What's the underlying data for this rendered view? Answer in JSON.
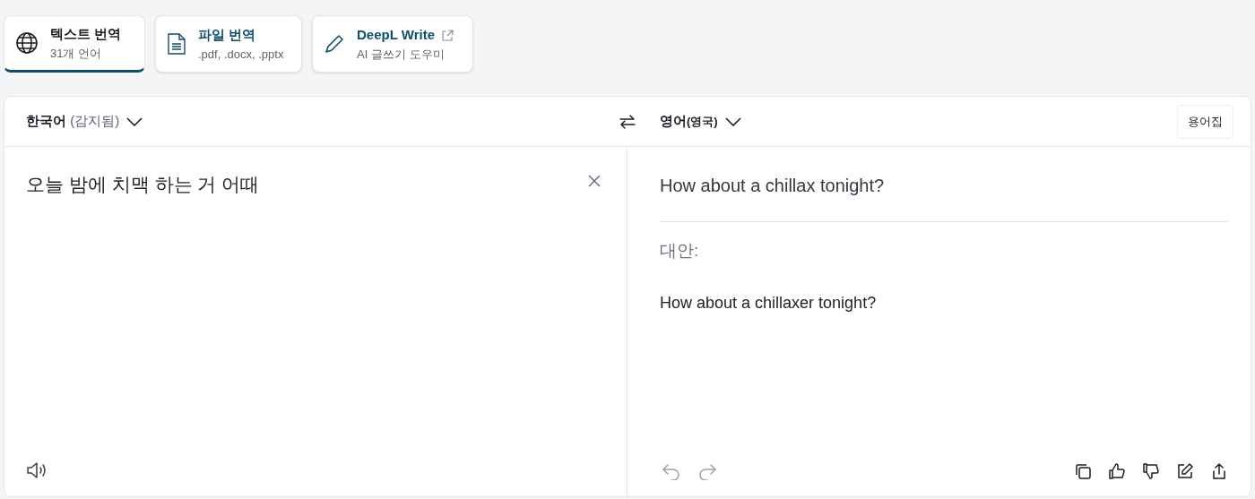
{
  "tabs": [
    {
      "kind": "text",
      "title": "텍스트 번역",
      "subtitle": "31개 언어",
      "selected": true
    },
    {
      "kind": "file",
      "title": "파일 번역",
      "subtitle": ".pdf, .docx, .pptx",
      "selected": false
    },
    {
      "kind": "write",
      "title": "DeepL Write",
      "subtitle": "AI 글쓰기 도우미",
      "selected": false
    }
  ],
  "source": {
    "language": "한국어",
    "detected": "(감지됨)",
    "text": "오늘 밤에 치맥 하는 거 어때"
  },
  "target": {
    "language": "영어",
    "variant": "(영국)",
    "glossary_button": "용어집",
    "translation": "How about a chillax tonight?",
    "alternatives_label": "대안:",
    "alternatives": [
      "How about a chillaxer tonight?"
    ]
  }
}
